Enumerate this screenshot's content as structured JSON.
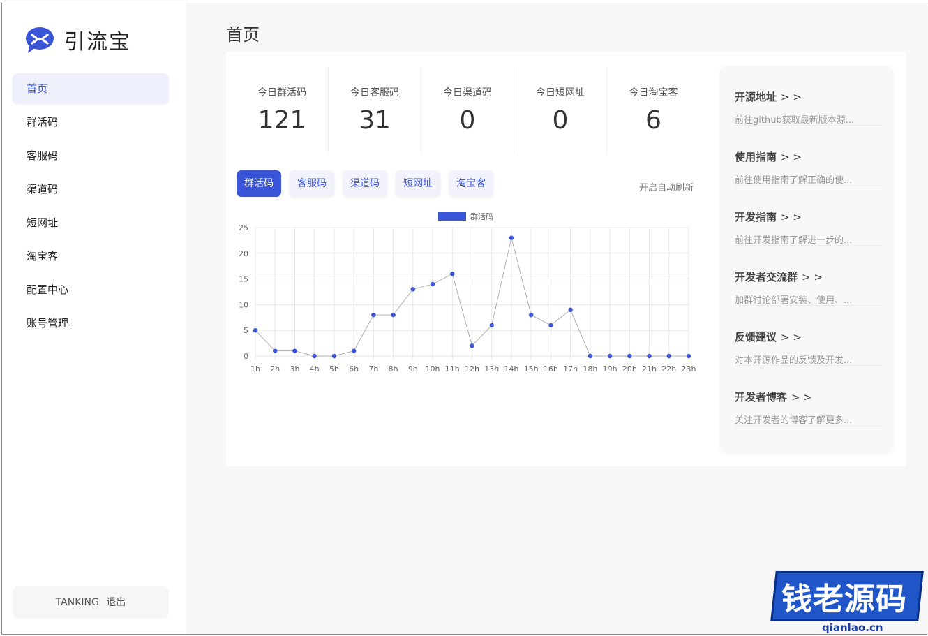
{
  "app": {
    "name": "引流宝"
  },
  "sidebar": {
    "items": [
      {
        "label": "首页",
        "active": true
      },
      {
        "label": "群活码"
      },
      {
        "label": "客服码"
      },
      {
        "label": "渠道码"
      },
      {
        "label": "短网址"
      },
      {
        "label": "淘宝客"
      },
      {
        "label": "配置中心"
      },
      {
        "label": "账号管理"
      }
    ],
    "user": "TANKING",
    "logout": "退出"
  },
  "header": {
    "title": "首页"
  },
  "stats": [
    {
      "label": "今日群活码",
      "value": "121"
    },
    {
      "label": "今日客服码",
      "value": "31"
    },
    {
      "label": "今日渠道码",
      "value": "0"
    },
    {
      "label": "今日短网址",
      "value": "0"
    },
    {
      "label": "今日淘宝客",
      "value": "6"
    }
  ],
  "tabs": [
    {
      "label": "群活码",
      "active": true
    },
    {
      "label": "客服码"
    },
    {
      "label": "渠道码"
    },
    {
      "label": "短网址"
    },
    {
      "label": "淘宝客"
    }
  ],
  "auto_refresh": "开启自动刷新",
  "chart_data": {
    "type": "line",
    "categories": [
      "1h",
      "2h",
      "3h",
      "4h",
      "5h",
      "6h",
      "7h",
      "8h",
      "9h",
      "10h",
      "11h",
      "12h",
      "13h",
      "14h",
      "15h",
      "16h",
      "17h",
      "18h",
      "19h",
      "20h",
      "21h",
      "22h",
      "23h"
    ],
    "series": [
      {
        "name": "群活码",
        "values": [
          5,
          1,
          1,
          0,
          0,
          1,
          8,
          8,
          13,
          14,
          16,
          2,
          6,
          23,
          8,
          6,
          9,
          0,
          0,
          0,
          0,
          0,
          0
        ]
      }
    ],
    "ylim": [
      0,
      25
    ],
    "yticks": [
      0,
      5,
      10,
      15,
      20,
      25
    ],
    "grid": true,
    "legend": "top-center",
    "colors": {
      "line": "#b0b0b0",
      "point": "#3b55d9",
      "legend": "#3b55d9"
    }
  },
  "links": [
    {
      "title": "开源地址",
      "arrow": "> >",
      "desc": "前往github获取最新版本源..."
    },
    {
      "title": "使用指南",
      "arrow": "> >",
      "desc": "前往使用指南了解正确的使..."
    },
    {
      "title": "开发指南",
      "arrow": "> >",
      "desc": "前往开发指南了解进一步的..."
    },
    {
      "title": "开发者交流群",
      "arrow": "> >",
      "desc": "加群讨论部署安装、使用、..."
    },
    {
      "title": "反馈建议",
      "arrow": "> >",
      "desc": "对本开源作品的反馈及开发..."
    },
    {
      "title": "开发者博客",
      "arrow": "> >",
      "desc": "关注开发者的博客了解更多..."
    }
  ],
  "watermark": {
    "text": "钱老源码",
    "url": "qianlao.cn"
  }
}
